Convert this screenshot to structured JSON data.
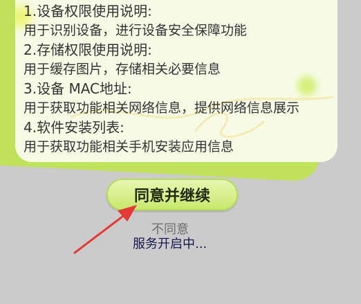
{
  "permissions_dialog": {
    "lines": [
      "1.设备权限使用说明:",
      "用于识别设备，进行设备安全保障功能",
      "2.存储权限使用说明:",
      "用于缓存图片，存储相关必要信息",
      "3.设备 MAC地址:",
      "用于获取功能相关网络信息，提供网络信息展示",
      "4.软件安装列表:",
      "用于获取功能相关手机安装应用信息"
    ]
  },
  "actions": {
    "agree_label": "同意并继续",
    "disagree_label": "不同意"
  },
  "status_text": "服务开启中...",
  "colors": {
    "background": "#cbcbcb",
    "card_back": "#bfe25a",
    "card_face": "#f7fbe6",
    "button": "#c7e86a",
    "arrow": "#e53935",
    "status": "#1a1752"
  },
  "icons": {
    "annotation": "red-arrow-icon"
  }
}
